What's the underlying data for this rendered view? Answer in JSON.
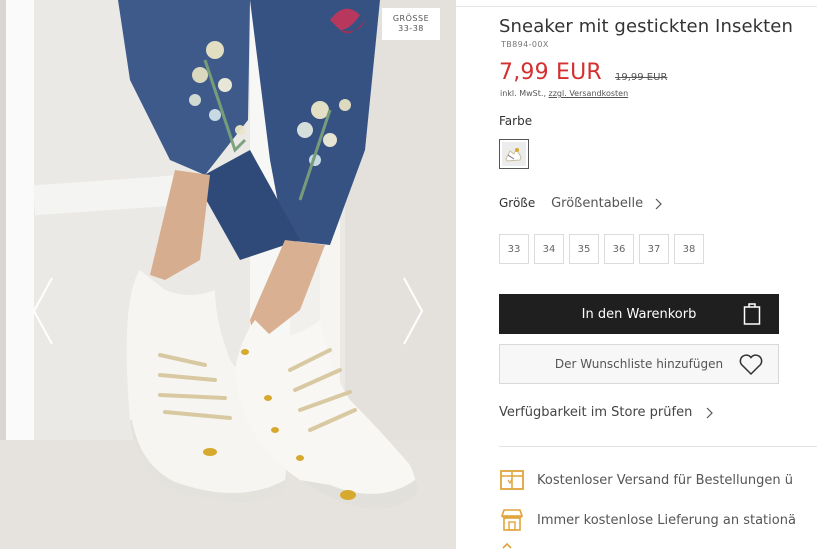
{
  "gallery": {
    "size_badge_line1": "GRÖSSE",
    "size_badge_line2": "33-38",
    "prev_icon": "chevron-left-icon",
    "next_icon": "chevron-right-icon"
  },
  "product": {
    "title": "Sneaker mit gestickten Insekten",
    "sku": "TB894-00X",
    "price": "7,99 EUR",
    "old_price": "19,99 EUR",
    "tax_note": "inkl. MwSt.,",
    "shipping_link": "zzgl. Versandkosten",
    "price_color": "#d43030"
  },
  "color": {
    "label": "Farbe"
  },
  "size": {
    "label": "Größe",
    "table_link": "Größentabelle",
    "options": [
      "33",
      "34",
      "35",
      "36",
      "37",
      "38"
    ]
  },
  "actions": {
    "cart_label": "In den Warenkorb",
    "cart_icon": "shopping-bag-icon",
    "wishlist_label": "Der Wunschliste hinzufügen",
    "wishlist_icon": "heart-icon",
    "store_check_label": "Verfügbarkeit im Store prüfen"
  },
  "benefits": [
    {
      "text": "Kostenloser Versand für Bestellungen ü",
      "icon": "box-icon"
    },
    {
      "text": "Immer kostenlose Lieferung an stationä",
      "icon": "store-icon"
    }
  ],
  "colors": {
    "accent": "#e0a33a",
    "button_dark": "#1f1f1f"
  }
}
